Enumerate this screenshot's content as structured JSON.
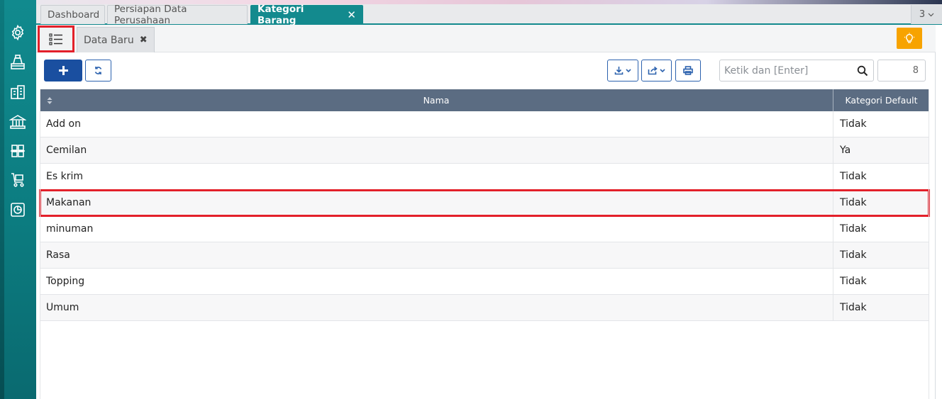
{
  "tabs": [
    {
      "label": "Dashboard"
    },
    {
      "label": "Persiapan Data Perusahaan"
    },
    {
      "label": "Kategori Barang"
    }
  ],
  "tab_count": "3",
  "subtab_label": "Data Baru",
  "search": {
    "placeholder": "Ketik dan [Enter]"
  },
  "record_count": "8",
  "table": {
    "headers": {
      "nama": "Nama",
      "kategori_default": "Kategori Default"
    },
    "rows": [
      {
        "nama": "Add on",
        "kategori_default": "Tidak"
      },
      {
        "nama": "Cemilan",
        "kategori_default": "Ya"
      },
      {
        "nama": "Es krim",
        "kategori_default": "Tidak"
      },
      {
        "nama": "Makanan",
        "kategori_default": "Tidak"
      },
      {
        "nama": "minuman",
        "kategori_default": "Tidak"
      },
      {
        "nama": "Rasa",
        "kategori_default": "Tidak"
      },
      {
        "nama": "Topping",
        "kategori_default": "Tidak"
      },
      {
        "nama": "Umum",
        "kategori_default": "Tidak"
      }
    ]
  },
  "sidebar_icons": [
    "gear-icon",
    "cashier-icon",
    "building-icon",
    "bank-icon",
    "inventory-icon",
    "cart-icon",
    "report-icon"
  ],
  "colors": {
    "sidebar": "#118a8e",
    "active_tab": "#138a8e",
    "primary": "#1a4fa0",
    "warning": "#f7a300",
    "highlight": "#e3202a",
    "table_header": "#5b6c82"
  }
}
